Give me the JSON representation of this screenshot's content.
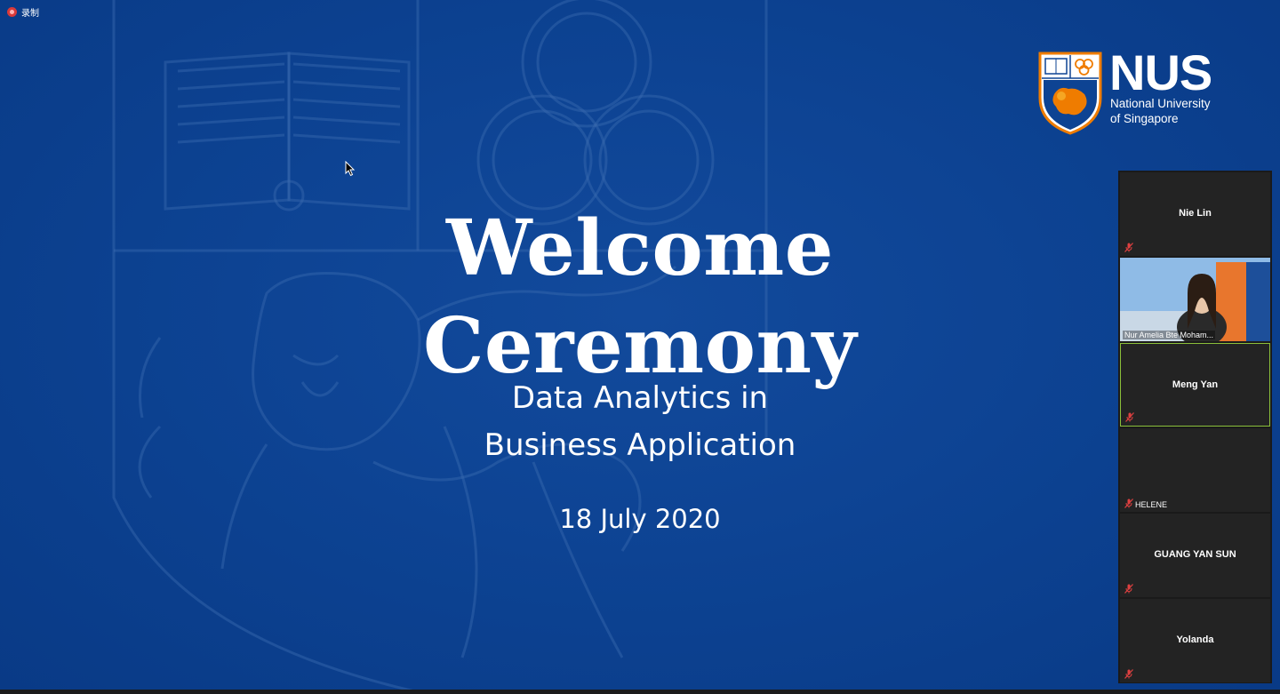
{
  "recording": {
    "label": "录制"
  },
  "slide": {
    "title": "Welcome Ceremony",
    "subtitle_line1": "Data Analytics in",
    "subtitle_line2": "Business Application",
    "date": "18 July 2020"
  },
  "logo": {
    "wordmark": "NUS",
    "name_line1": "National University",
    "name_line2": "of Singapore"
  },
  "participants": [
    {
      "name": "Nie Lin",
      "muted": true,
      "video": false
    },
    {
      "name": "Nur Amelia Bte Moham...",
      "muted": false,
      "video": true
    },
    {
      "name": "Meng Yan",
      "muted": true,
      "video": false,
      "active_speaker": true
    },
    {
      "name": "HELENE",
      "muted": true,
      "video": false
    },
    {
      "name": "GUANG YAN SUN",
      "muted": true,
      "video": false
    },
    {
      "name": "Yolanda",
      "muted": true,
      "video": false
    }
  ],
  "colors": {
    "slide_background": "#0d4393",
    "logo_orange": "#ef7c00",
    "active_speaker_border": "#8bbf3a",
    "muted_icon": "#e04040",
    "panel_background": "#1a1a1a"
  }
}
